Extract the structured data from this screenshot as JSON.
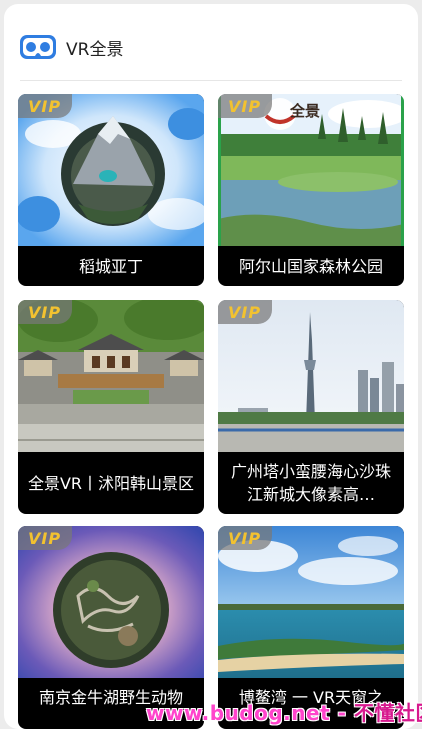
{
  "header": {
    "icon": "vr-headset-icon",
    "title": "VR全景",
    "accent": "#2f7de1"
  },
  "vip_label": "VIP",
  "cards": [
    {
      "title": "稻城亚丁"
    },
    {
      "title": "阿尔山国家森林公园",
      "logo_text": "全景"
    },
    {
      "title": "全景VR丨沭阳韩山景区"
    },
    {
      "title": "广州塔小蛮腰海心沙珠江新城大像素高…"
    },
    {
      "title": "南京金牛湖野生动物"
    },
    {
      "title": "博鳌湾 一 VR天窗之"
    }
  ],
  "watermark": {
    "site": "www.budog.net",
    "sep": " - ",
    "name": "不懂社区"
  }
}
